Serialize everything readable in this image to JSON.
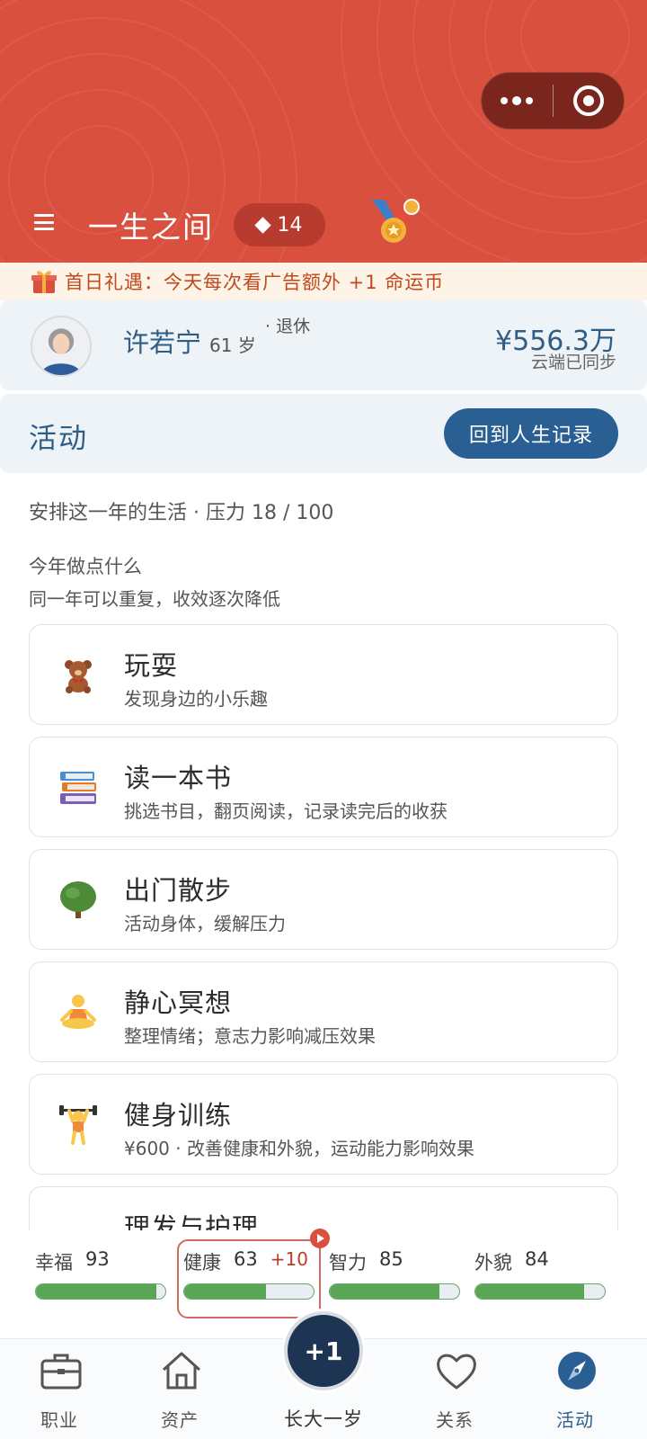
{
  "header": {
    "title": "一生之间",
    "gem_count": "14",
    "theme_color": "#d9503f"
  },
  "gift_bar": {
    "text": "首日礼遇：今天每次看广告额外 +1 命运币"
  },
  "profile": {
    "name": "许若宁",
    "age": "61 岁",
    "status": "· 退休",
    "money": "¥556.3万",
    "sync_status": "云端已同步"
  },
  "section": {
    "title": "活动",
    "back_button": "回到人生记录",
    "summary": "安排这一年的生活 · 压力 18 / 100",
    "prompt": "今年做点什么",
    "hint": "同一年可以重复，收效逐次降低"
  },
  "activities": [
    {
      "name": "玩耍",
      "desc": "发现身边的小乐趣",
      "icon": "teddy-bear-icon"
    },
    {
      "name": "读一本书",
      "desc": "挑选书目，翻页阅读，记录读完后的收获",
      "icon": "books-icon"
    },
    {
      "name": "出门散步",
      "desc": "活动身体，缓解压力",
      "icon": "tree-icon"
    },
    {
      "name": "静心冥想",
      "desc": "整理情绪；意志力影响减压效果",
      "icon": "meditation-icon"
    },
    {
      "name": "健身训练",
      "desc": "¥600 · 改善健康和外貌，运动能力影响效果",
      "icon": "weightlifter-icon"
    },
    {
      "name": "理发与护理",
      "desc": "",
      "icon": "scissors-icon"
    }
  ],
  "stats": [
    {
      "label": "幸福",
      "value": 93,
      "delta": ""
    },
    {
      "label": "健康",
      "value": 63,
      "delta": "+10"
    },
    {
      "label": "智力",
      "value": 85,
      "delta": ""
    },
    {
      "label": "外貌",
      "value": 84,
      "delta": ""
    }
  ],
  "nav": {
    "career": "职业",
    "assets": "资产",
    "grow": "长大一岁",
    "grow_button": "+1",
    "relations": "关系",
    "activities": "活动",
    "active_color": "#2a5f93"
  }
}
